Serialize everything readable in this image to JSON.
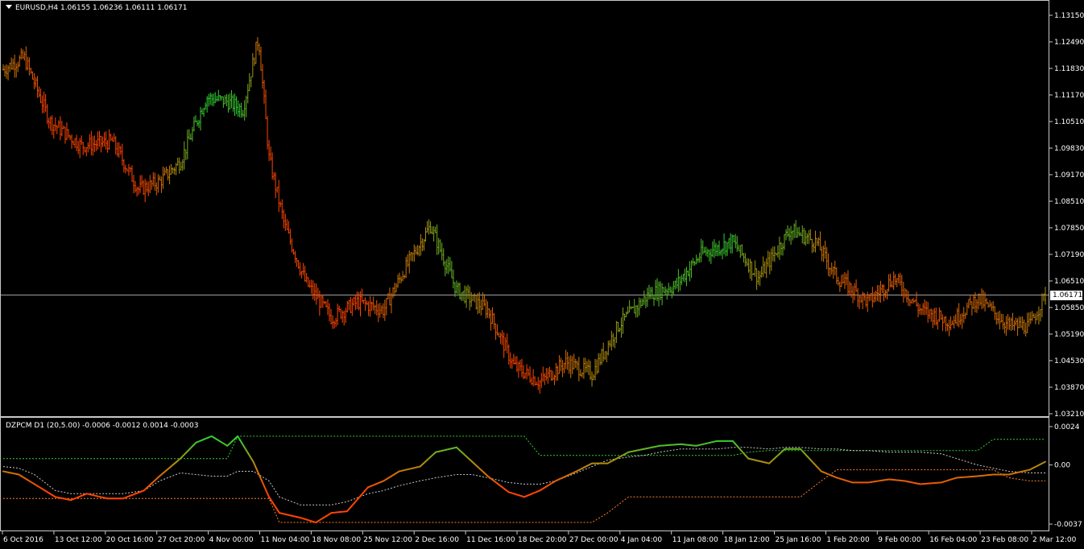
{
  "main_chart": {
    "symbol_label": "EURUSD,H4  1.06155 1.06236 1.06111 1.06171",
    "current_price": "1.06171",
    "current_price_value": 1.06171
  },
  "indicator": {
    "label": "DZPCM D1 (20,5.00) -0.0006 -0.0012 0.0014 -0.0003"
  },
  "colors": {
    "background": "#000000",
    "bear": "#ff4500",
    "bull": "#32cd32",
    "neutral": "#b8860b",
    "pane_border": "#c8c8c8",
    "bid_line": "#a0a0a0",
    "upper_band": "#32cd32",
    "lower_band": "#ff7f24",
    "signal": "#c8c8c8"
  },
  "chart_data": [
    {
      "type": "line",
      "title": "",
      "price_ticks": [
        "1.13150",
        "1.12490",
        "1.11830",
        "1.11170",
        "1.10510",
        "1.09830",
        "1.09170",
        "1.08510",
        "1.07850",
        "1.07190",
        "1.06510",
        "1.05850",
        "1.05190",
        "1.04530",
        "1.03870",
        "1.03210"
      ],
      "x_ticks": [
        "6 Oct 2016",
        "13 Oct 12:00",
        "20 Oct 16:00",
        "27 Oct 20:00",
        "4 Nov 00:00",
        "11 Nov 04:00",
        "18 Nov 08:00",
        "25 Nov 12:00",
        "2 Dec 16:00",
        "11 Dec 16:00",
        "18 Dec 20:00",
        "27 Dec 00:00",
        "4 Jan 04:00",
        "11 Jan 08:00",
        "18 Jan 12:00",
        "25 Jan 16:00",
        "1 Feb 20:00",
        "9 Feb 00:00",
        "16 Feb 04:00",
        "23 Feb 08:00",
        "2 Mar 12:00"
      ],
      "ylim": [
        1.0321,
        1.1315
      ],
      "series": [
        {
          "x": [
            0,
            0.4,
            0.9,
            1.5,
            2.1,
            2.6,
            3.0,
            3.4,
            3.9,
            4.3,
            4.6,
            4.9,
            5.1,
            5.4,
            5.8,
            6.3,
            6.8,
            7.3,
            7.7,
            8.2,
            8.7,
            9.3,
            9.8,
            10.3,
            10.8,
            11.3,
            11.8,
            12.4,
            12.9,
            13.4,
            14.0,
            14.5,
            15.1,
            15.6,
            16.0,
            16.6,
            17.1,
            17.6,
            18.2,
            18.7,
            19.3,
            19.7,
            20.0
          ],
          "values": [
            1.118,
            1.121,
            1.105,
            1.099,
            1.1,
            1.088,
            1.09,
            1.095,
            1.111,
            1.11,
            1.108,
            1.126,
            1.096,
            1.079,
            1.065,
            1.056,
            1.06,
            1.058,
            1.068,
            1.079,
            1.063,
            1.058,
            1.044,
            1.04,
            1.045,
            1.042,
            1.054,
            1.062,
            1.064,
            1.072,
            1.075,
            1.066,
            1.078,
            1.075,
            1.066,
            1.06,
            1.066,
            1.058,
            1.055,
            1.061,
            1.054,
            1.054,
            1.0617
          ]
        }
      ]
    },
    {
      "type": "line",
      "title": "",
      "y_ticks": [
        "0.0024",
        "0.00",
        "-0.0037"
      ],
      "ylim": [
        -0.0039,
        0.0026
      ],
      "x": [
        0,
        0.3,
        0.6,
        1.0,
        1.3,
        1.6,
        2.0,
        2.3,
        2.7,
        3.0,
        3.4,
        3.7,
        4.0,
        4.3,
        4.5,
        4.8,
        5.1,
        5.3,
        5.7,
        6.0,
        6.3,
        6.6,
        7.0,
        7.3,
        7.6,
        8.0,
        8.3,
        8.7,
        9.0,
        9.3,
        9.7,
        10.0,
        10.3,
        10.6,
        11.0,
        11.3,
        11.6,
        12.0,
        12.3,
        12.6,
        13.0,
        13.3,
        13.7,
        14.0,
        14.3,
        14.7,
        15.0,
        15.3,
        15.7,
        16.0,
        16.3,
        16.6,
        17.0,
        17.3,
        17.6,
        18.0,
        18.3,
        18.7,
        19.0,
        19.3,
        19.7,
        20.0
      ],
      "series": [
        {
          "values": [
            -0.0004,
            -0.0006,
            -0.0012,
            -0.002,
            -0.0022,
            -0.0018,
            -0.0021,
            -0.0021,
            -0.0016,
            -0.0007,
            0.0004,
            0.0014,
            0.0018,
            0.0012,
            0.0018,
            0.0002,
            -0.002,
            -0.003,
            -0.0033,
            -0.0036,
            -0.003,
            -0.0029,
            -0.0014,
            -0.001,
            -0.0004,
            -0.0001,
            0.0008,
            0.0011,
            0.0002,
            -0.0007,
            -0.0017,
            -0.002,
            -0.0016,
            -0.001,
            -0.0004,
            0.0001,
            0.0001,
            0.0008,
            0.001,
            0.0012,
            0.0013,
            0.0012,
            0.0015,
            0.0015,
            0.0004,
            0.0001,
            0.001,
            0.001,
            -0.0004,
            -0.0008,
            -0.0011,
            -0.0011,
            -0.0009,
            -0.001,
            -0.0012,
            -0.0011,
            -0.0008,
            -0.0007,
            -0.0006,
            -0.0006,
            -0.0003,
            0.0002
          ]
        },
        {
          "values": [
            0.0004,
            0.0004,
            0.0004,
            0.0004,
            0.0004,
            0.0004,
            0.0004,
            0.0004,
            0.0004,
            0.0004,
            0.0004,
            0.0004,
            0.0004,
            0.0004,
            0.0018,
            0.0018,
            0.0018,
            0.0018,
            0.0018,
            0.0018,
            0.0018,
            0.0018,
            0.0018,
            0.0018,
            0.0018,
            0.0018,
            0.0018,
            0.0018,
            0.0018,
            0.0018,
            0.0018,
            0.0018,
            0.0006,
            0.0006,
            0.0006,
            0.0006,
            0.0006,
            0.0006,
            0.0006,
            0.0006,
            0.0006,
            0.0006,
            0.0006,
            0.0006,
            0.0008,
            0.0009,
            0.0009,
            0.0009,
            0.0009,
            0.0009,
            0.0009,
            0.0009,
            0.0009,
            0.0009,
            0.0009,
            0.0009,
            0.0009,
            0.0009,
            0.0016,
            0.0016,
            0.0016,
            0.0016
          ]
        },
        {
          "values": [
            -0.0021,
            -0.0021,
            -0.0021,
            -0.0021,
            -0.0021,
            -0.0021,
            -0.0021,
            -0.0021,
            -0.0021,
            -0.0021,
            -0.0021,
            -0.0021,
            -0.0021,
            -0.0021,
            -0.0021,
            -0.0021,
            -0.0021,
            -0.0036,
            -0.0036,
            -0.0036,
            -0.0036,
            -0.0036,
            -0.0036,
            -0.0036,
            -0.0036,
            -0.0036,
            -0.0036,
            -0.0036,
            -0.0036,
            -0.0036,
            -0.0036,
            -0.0036,
            -0.0036,
            -0.0036,
            -0.0036,
            -0.0036,
            -0.003,
            -0.002,
            -0.002,
            -0.002,
            -0.002,
            -0.002,
            -0.002,
            -0.002,
            -0.002,
            -0.002,
            -0.002,
            -0.002,
            -0.001,
            -0.0003,
            -0.0003,
            -0.0003,
            -0.0003,
            -0.0003,
            -0.0003,
            -0.0003,
            -0.0003,
            -0.0003,
            -0.0003,
            -0.0008,
            -0.001,
            -0.001
          ]
        },
        {
          "values": [
            -0.0001,
            -0.0002,
            -0.0006,
            -0.0016,
            -0.0018,
            -0.0018,
            -0.0018,
            -0.0018,
            -0.0016,
            -0.001,
            -0.0005,
            -0.0006,
            -0.0007,
            -0.0007,
            -0.0004,
            -0.0004,
            -0.001,
            -0.002,
            -0.0025,
            -0.0025,
            -0.0025,
            -0.0023,
            -0.0018,
            -0.0016,
            -0.0013,
            -0.001,
            -0.0008,
            -0.0006,
            -0.0006,
            -0.0008,
            -0.0011,
            -0.0012,
            -0.0012,
            -0.001,
            -0.0005,
            -0.0001,
            0.0003,
            0.0005,
            0.0006,
            0.0008,
            0.001,
            0.001,
            0.001,
            0.0011,
            0.0011,
            0.001,
            0.0011,
            0.0011,
            0.001,
            0.001,
            0.0009,
            0.0009,
            0.0008,
            0.0008,
            0.0008,
            0.0007,
            0.0004,
            0.0,
            -0.0002,
            -0.0004,
            -0.0005,
            -0.0005
          ]
        }
      ]
    }
  ]
}
